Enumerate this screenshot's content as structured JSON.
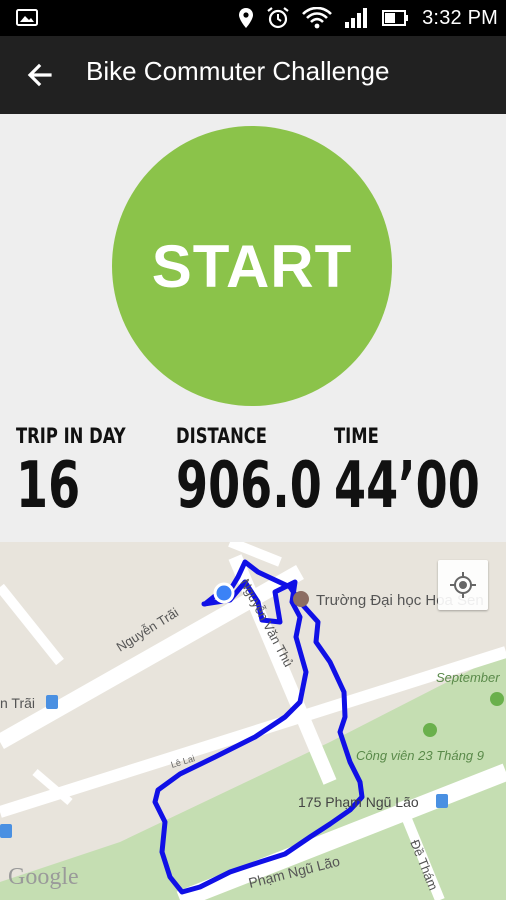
{
  "status_bar": {
    "time": "3:32 PM",
    "icons": [
      "photo-icon",
      "location-icon",
      "alarm-icon",
      "wifi-icon",
      "signal-icon",
      "battery-icon"
    ]
  },
  "toolbar": {
    "title": "Bike Commuter Challenge",
    "back_icon": "arrow-back-icon"
  },
  "start_button": {
    "label": "START",
    "color": "#8bc34a"
  },
  "stats": [
    {
      "label": "TRIP IN DAY",
      "value": "16"
    },
    {
      "label": "DISTANCE",
      "value": "906.0"
    },
    {
      "label": "TIME",
      "value": "44’00"
    }
  ],
  "map": {
    "labels": {
      "poi_university": "Trường Đại học Hoa Sen",
      "street_nguyen_trai": "Nguyễn Trãi",
      "street_nguyen_trai_2": "n Trãi",
      "street_nguyen_van_thu": "Nguyễn Văn Thủ",
      "street_le_lai": "Lê Lai",
      "park": "Công viên 23 Tháng 9",
      "september": "September",
      "bus_stop": "175 Phạm Ngũ Lão",
      "street_pham_ngu_lao": "Phạm Ngũ Lão",
      "street_de_tham": "Đề Thám",
      "watermark": "Google"
    },
    "route_color": "#1010e6",
    "park_color": "#c5deb2"
  }
}
